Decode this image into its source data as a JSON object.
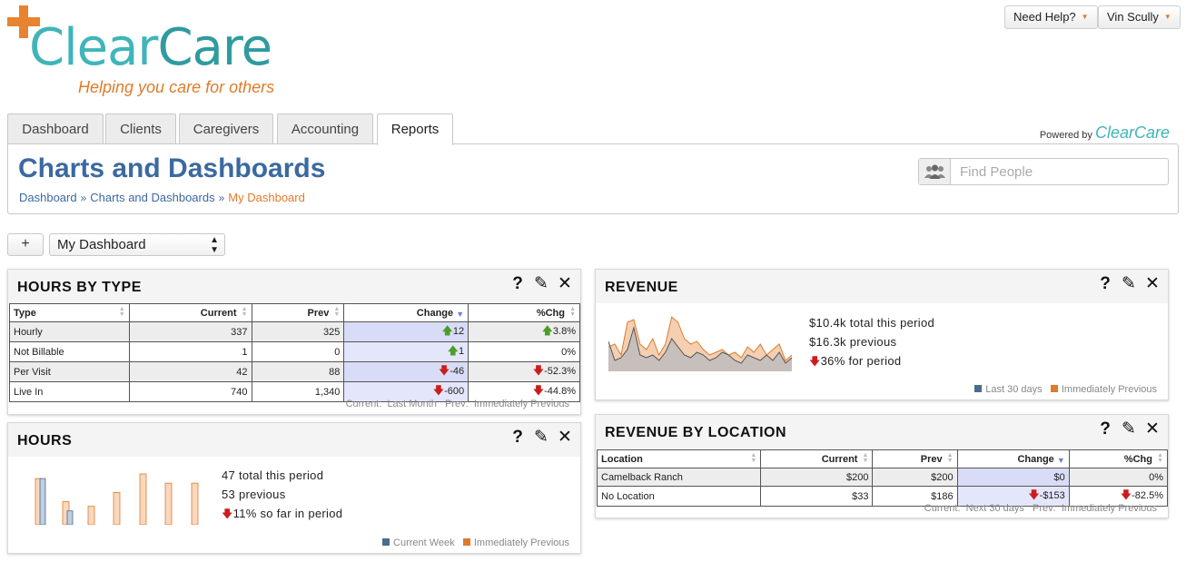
{
  "header": {
    "brand": "ClearCare",
    "brand_part1": "Clear",
    "brand_part2": "Care",
    "tagline": "Helping you care for others",
    "help_button": "Need Help?",
    "user_button": "Vin Scully",
    "powered_by": "Powered by",
    "powered_brand": "ClearCare"
  },
  "tabs": [
    {
      "label": "Dashboard"
    },
    {
      "label": "Clients"
    },
    {
      "label": "Caregivers"
    },
    {
      "label": "Accounting"
    },
    {
      "label": "Reports",
      "active": true
    }
  ],
  "page": {
    "title": "Charts and Dashboards",
    "breadcrumbs": [
      "Dashboard",
      "Charts and Dashboards",
      "My Dashboard"
    ],
    "search_placeholder": "Find People"
  },
  "toolbar": {
    "add_label": "+",
    "dashboard_select": "My Dashboard"
  },
  "icons": [
    "people-icon",
    "question-icon",
    "edit-icon",
    "close-icon",
    "arrow-up-icon",
    "arrow-down-icon",
    "sort-icon"
  ],
  "colors": {
    "title_blue": "#3b69a0",
    "brand_teal": "#3fb5b9",
    "accent_orange": "#e07b2a",
    "up_green": "#4a9e2a",
    "down_red": "#cc1d1d",
    "current_series": "#4a6b8a",
    "previous_series": "#e07b2a"
  },
  "widgets": {
    "hours_by_type": {
      "title": "HOURS BY TYPE",
      "columns": [
        "Type",
        "Current",
        "Prev",
        "Change",
        "%Chg"
      ],
      "rows": [
        {
          "type": "Hourly",
          "current": "337",
          "prev": "325",
          "change": "12",
          "change_dir": "up",
          "pct": "3.8%",
          "pct_dir": "up"
        },
        {
          "type": "Not Billable",
          "current": "1",
          "prev": "0",
          "change": "1",
          "change_dir": "up",
          "pct": "0%",
          "pct_dir": ""
        },
        {
          "type": "Per Visit",
          "current": "42",
          "prev": "88",
          "change": "-46",
          "change_dir": "down",
          "pct": "-52.3%",
          "pct_dir": "down"
        },
        {
          "type": "Live In",
          "current": "740",
          "prev": "1,340",
          "change": "-600",
          "change_dir": "down",
          "pct": "-44.8%",
          "pct_dir": "down"
        }
      ],
      "footer_current_key": "Current:",
      "footer_current_val": "Last Month",
      "footer_prev_key": "Prev:",
      "footer_prev_val": "Immediately Previous"
    },
    "revenue": {
      "title": "REVENUE",
      "total": "$10.4k total this period",
      "previous": "$16.3k previous",
      "change": "36% for period",
      "change_dir": "down",
      "legend_current": "Last 30 days",
      "legend_previous": "Immediately Previous"
    },
    "hours": {
      "title": "HOURS",
      "total": "47 total this period",
      "previous": "53 previous",
      "change": "11% so far in period",
      "change_dir": "down",
      "legend_current": "Current Week",
      "legend_previous": "Immediately Previous"
    },
    "revenue_by_location": {
      "title": "REVENUE BY LOCATION",
      "columns": [
        "Location",
        "Current",
        "Prev",
        "Change",
        "%Chg"
      ],
      "rows": [
        {
          "location": "Camelback Ranch",
          "current": "$200",
          "prev": "$200",
          "change": "$0",
          "change_dir": "",
          "pct": "0%",
          "pct_dir": ""
        },
        {
          "location": "No Location",
          "current": "$33",
          "prev": "$186",
          "change": "-$153",
          "change_dir": "down",
          "pct": "-82.5%",
          "pct_dir": "down"
        }
      ],
      "footer_current_key": "Current:",
      "footer_current_val": "Next 30 days",
      "footer_prev_key": "Prev:",
      "footer_prev_val": "Immediately Previous"
    }
  },
  "chart_data": [
    {
      "type": "area",
      "series": [
        {
          "name": "Last 30 days",
          "values": [
            0.55,
            0.2,
            0.25,
            0.4,
            0.8,
            0.3,
            0.25,
            0.3,
            0.2,
            0.35,
            0.6,
            0.45,
            0.3,
            0.25,
            0.35,
            0.3,
            0.2,
            0.25,
            0.35,
            0.3,
            0.2,
            0.15,
            0.3,
            0.25,
            0.2,
            0.3,
            0.2,
            0.35,
            0.15,
            0.25
          ]
        },
        {
          "name": "Immediately Previous",
          "values": [
            0.45,
            0.5,
            0.3,
            0.9,
            0.95,
            0.5,
            0.4,
            0.6,
            0.3,
            0.5,
            1.0,
            0.9,
            0.6,
            0.5,
            0.55,
            0.4,
            0.3,
            0.35,
            0.4,
            0.3,
            0.35,
            0.25,
            0.45,
            0.35,
            0.5,
            0.3,
            0.4,
            0.5,
            0.2,
            0.3
          ]
        }
      ]
    },
    {
      "type": "bar",
      "series": [
        {
          "name": "Current Week",
          "values": [
            10,
            3
          ]
        },
        {
          "name": "Immediately Previous",
          "values": [
            10,
            5,
            4,
            7,
            11,
            9,
            9
          ]
        }
      ]
    }
  ]
}
